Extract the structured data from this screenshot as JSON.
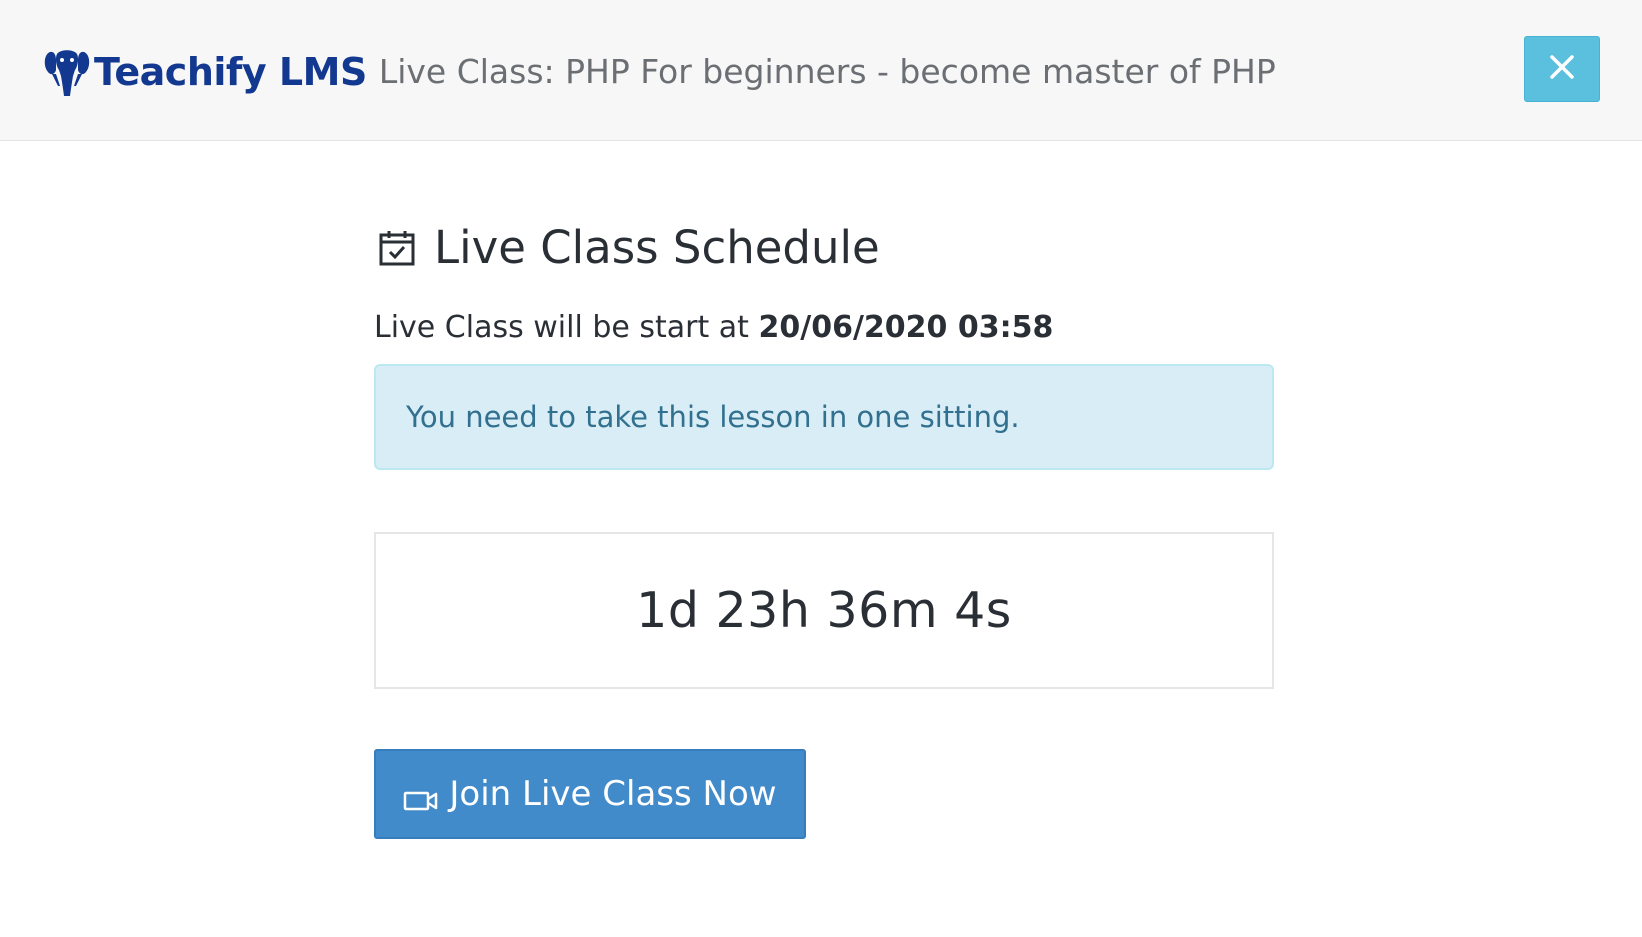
{
  "header": {
    "brand_name": "Teachify LMS",
    "lesson_title": "Live Class: PHP For beginners - become master of PHP",
    "logo_icon": "elephant-logo-icon",
    "close_icon": "close-icon"
  },
  "schedule": {
    "title": "Live Class Schedule",
    "title_icon": "calendar-check-icon",
    "start_prefix": "Live Class will be start at",
    "start_datetime": "20/06/2020 03:58"
  },
  "alert": {
    "message": "You need to take this lesson in one sitting."
  },
  "countdown": {
    "text": "1d 23h 36m 4s"
  },
  "join_button": {
    "label": "Join Live Class Now",
    "icon": "video-camera-icon"
  },
  "colors": {
    "brand": "#13388f",
    "close_button": "#5bc0de",
    "alert_bg": "#d9edf7",
    "alert_text": "#31708f",
    "primary_button": "#428bca"
  }
}
